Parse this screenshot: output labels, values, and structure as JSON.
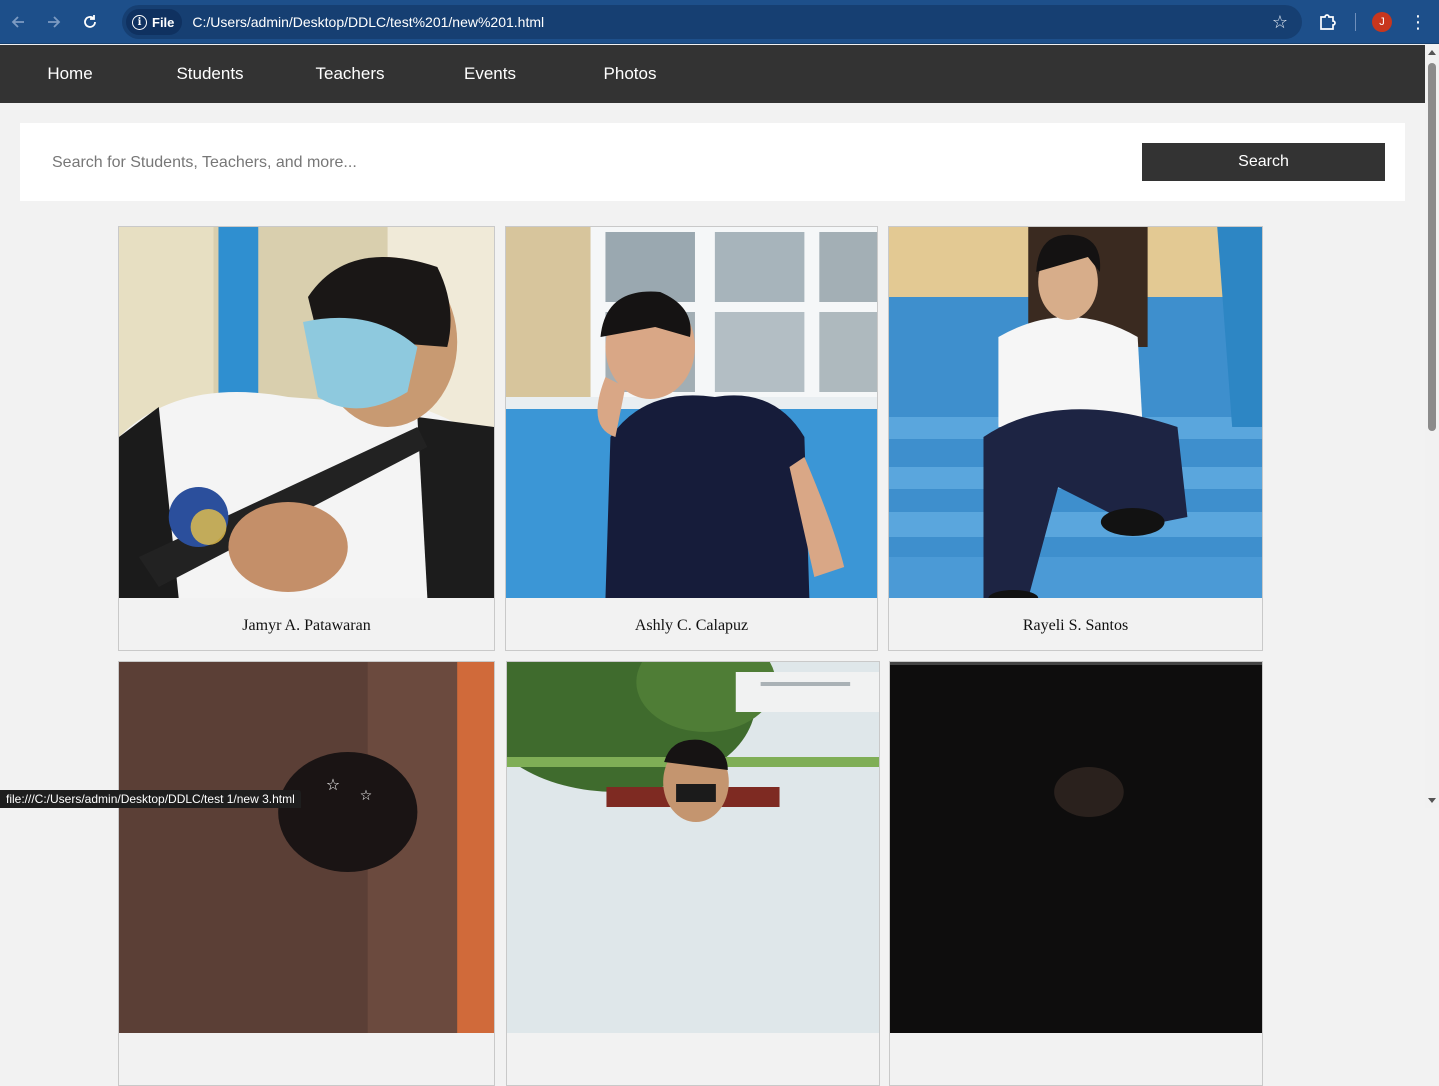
{
  "browser": {
    "file_label": "File",
    "url": "C:/Users/admin/Desktop/DDLC/test%201/new%201.html",
    "profile_initial": "J",
    "status_url": "file:///C:/Users/admin/Desktop/DDLC/test 1/new 3.html"
  },
  "nav": {
    "items": [
      "Home",
      "Students",
      "Teachers",
      "Events",
      "Photos"
    ]
  },
  "search": {
    "placeholder": "Search for Students, Teachers, and more...",
    "button_label": "Search"
  },
  "cards": [
    {
      "name": "Jamyr A. Patawaran"
    },
    {
      "name": "Ashly C. Calapuz"
    },
    {
      "name": "Rayeli S. Santos"
    },
    {
      "name": ""
    },
    {
      "name": ""
    },
    {
      "name": ""
    }
  ]
}
